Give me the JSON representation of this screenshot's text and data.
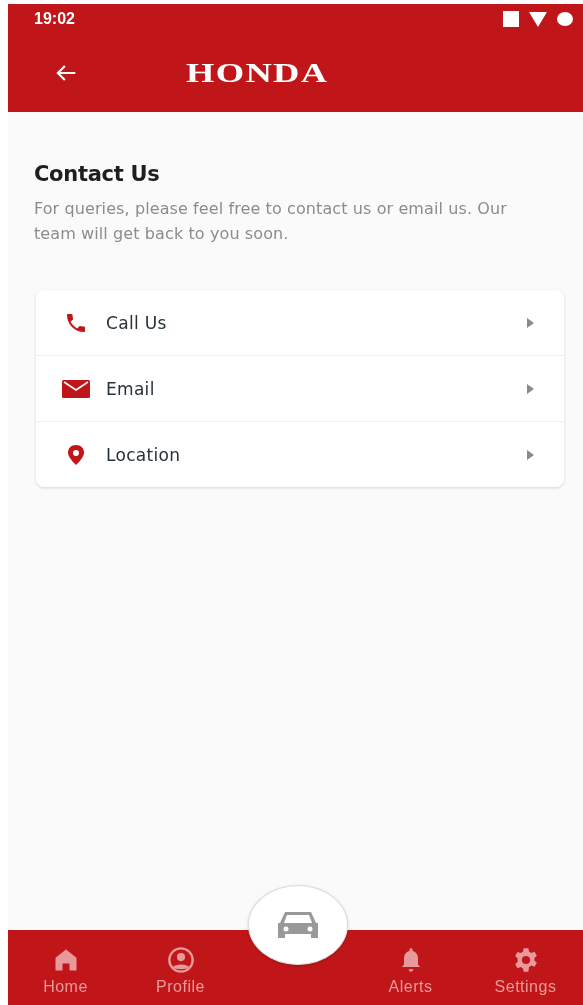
{
  "status_bar": {
    "time": "19:02"
  },
  "app_bar": {
    "logo": "HONDA"
  },
  "contact": {
    "title": "Contact Us",
    "description": "For queries, please feel free to contact us or email us. Our team will get back to you soon.",
    "options": [
      {
        "kind": "phone",
        "label": "Call Us"
      },
      {
        "kind": "email",
        "label": "Email"
      },
      {
        "kind": "location",
        "label": "Location"
      }
    ]
  },
  "bottom_nav": {
    "items": [
      {
        "kind": "home",
        "label": "Home"
      },
      {
        "kind": "profile",
        "label": "Profile"
      },
      {
        "kind": "car"
      },
      {
        "kind": "alerts",
        "label": "Alerts"
      },
      {
        "kind": "settings",
        "label": "Settings"
      }
    ]
  }
}
